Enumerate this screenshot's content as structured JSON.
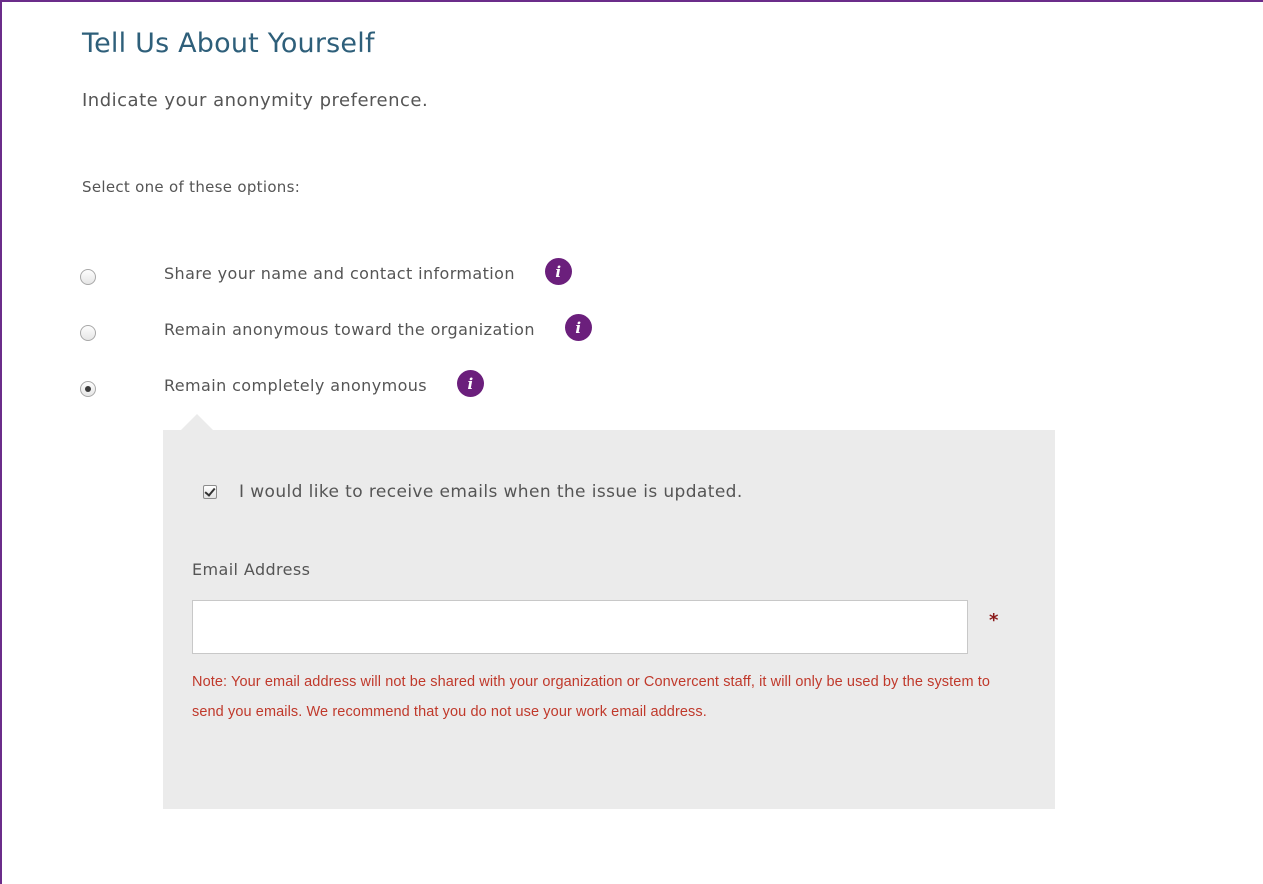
{
  "header": {
    "title": "Tell Us About Yourself",
    "subtitle": "Indicate your anonymity preference."
  },
  "prompt": "Select one of these options:",
  "options": [
    {
      "label": "Share your name and contact information",
      "selected": false,
      "info_icon": "info-icon"
    },
    {
      "label": "Remain anonymous toward the organization",
      "selected": false,
      "info_icon": "info-icon"
    },
    {
      "label": "Remain completely anonymous",
      "selected": true,
      "info_icon": "info-icon"
    }
  ],
  "anonymous_panel": {
    "email_updates_checkbox": {
      "label": "I would like to receive emails when the issue is updated.",
      "checked": true
    },
    "email_field": {
      "label": "Email Address",
      "value": "",
      "placeholder": "",
      "required_mark": "*"
    },
    "note": "Note: Your email address will not be shared with your organization or Convercent staff, it will only be used by the system to send you emails. We recommend that you do not use your work email address."
  },
  "colors": {
    "accent_purple": "#6b1f7c",
    "title_blue": "#2e5f7a",
    "note_red": "#c0392b",
    "panel_gray": "#ebebeb"
  }
}
